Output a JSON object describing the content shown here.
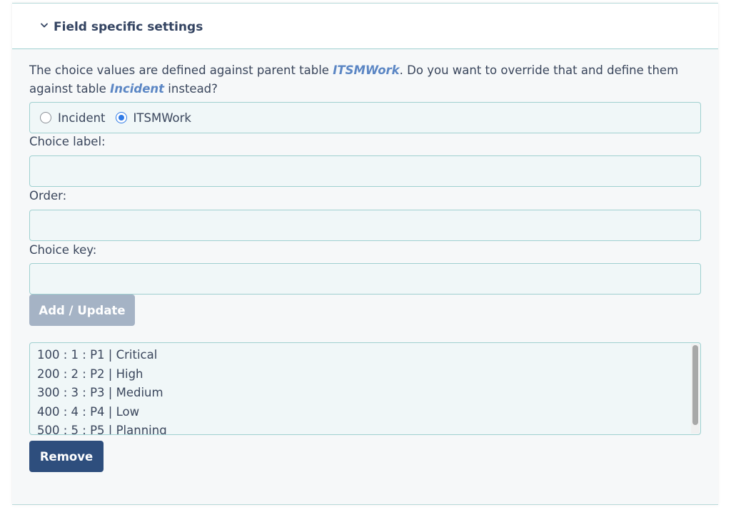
{
  "section": {
    "title": "Field specific settings"
  },
  "intro": {
    "part1": "The choice values are defined against parent table ",
    "parent_table": "ITSMWork",
    "part2": ". Do you want to override that and define them against table ",
    "current_table": "Incident",
    "part3": " instead?"
  },
  "radio_options": [
    {
      "label": "Incident",
      "checked": false
    },
    {
      "label": "ITSMWork",
      "checked": true
    }
  ],
  "fields": {
    "choice_label": {
      "label": "Choice label:",
      "value": ""
    },
    "order": {
      "label": "Order:",
      "value": ""
    },
    "choice_key": {
      "label": "Choice key:",
      "value": ""
    }
  },
  "buttons": {
    "add_update": "Add / Update",
    "remove": "Remove"
  },
  "choices": [
    "100 : 1 : P1 | Critical",
    "200 : 2 : P2 | High",
    "300 : 3 : P3 | Medium",
    "400 : 4 : P4 | Low",
    "500 : 5 : P5 | Planning"
  ],
  "icons": {
    "section_toggle": "chevron-down-icon"
  },
  "colors": {
    "accent_link": "#5b86c4",
    "primary_button": "#2e4e7d",
    "disabled_button": "#a5b3c5",
    "border": "#9fd0d0",
    "radio_selected": "#2f7be6"
  }
}
